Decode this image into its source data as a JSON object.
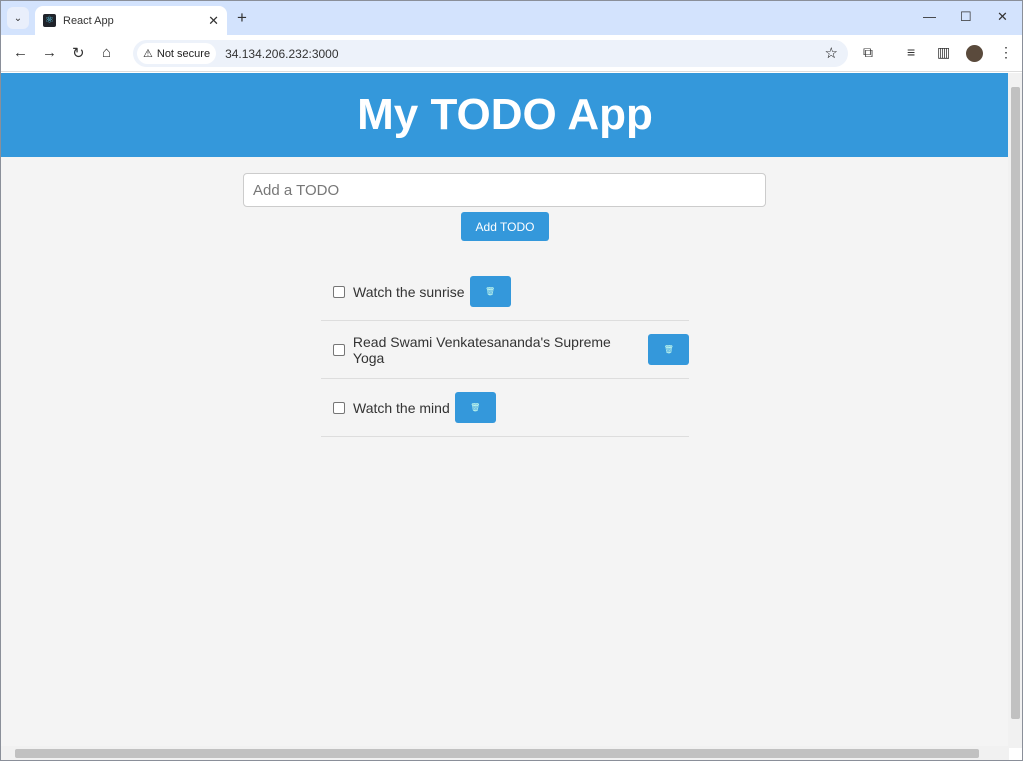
{
  "browser": {
    "tab_title": "React App",
    "not_secure_label": "Not secure",
    "url": "34.134.206.232:3000"
  },
  "app": {
    "title": "My TODO App",
    "input_placeholder": "Add a TODO",
    "input_value": "",
    "add_button_label": "Add TODO",
    "delete_icon": "trash-icon",
    "todos": [
      {
        "text": "Watch the sunrise",
        "done": false
      },
      {
        "text": "Read Swami Venkatesananda's Supreme Yoga",
        "done": false
      },
      {
        "text": "Watch the mind",
        "done": false
      }
    ]
  },
  "colors": {
    "accent": "#3498db",
    "background": "#f4f4f4"
  }
}
